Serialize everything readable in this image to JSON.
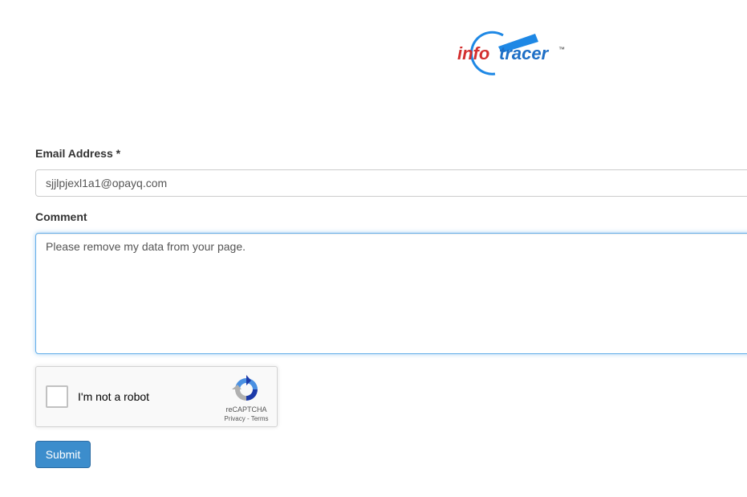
{
  "brand": {
    "logo_icon": "infotracer-logo",
    "primary_color": "#1e88e5",
    "accent_color": "#d32f2f",
    "text_info": "info",
    "text_tracer": "tracer",
    "trademark": "™"
  },
  "form": {
    "email_label": "Email Address *",
    "email_value": "sjjlpjexl1a1@opayq.com",
    "comment_label": "Comment",
    "comment_value": "Please remove my data from your page.",
    "submit_label": "Submit",
    "submit_color": "#3c8dcc"
  },
  "captcha": {
    "checkbox_label": "I'm not a robot",
    "brand": "reCAPTCHA",
    "privacy": "Privacy",
    "separator": " - ",
    "terms": "Terms",
    "icon": "recaptcha-icon"
  }
}
